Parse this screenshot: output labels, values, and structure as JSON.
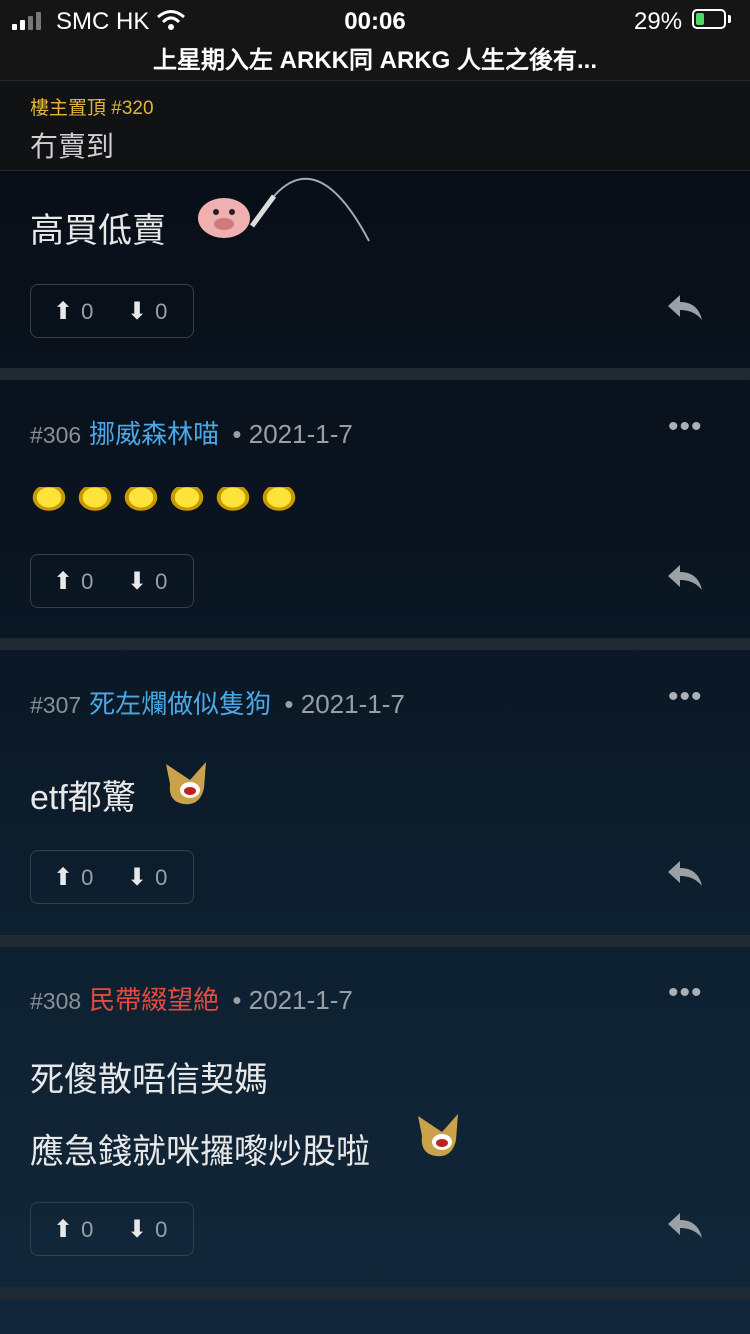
{
  "status_bar": {
    "carrier": "SMC HK",
    "time": "00:06",
    "battery": "29%",
    "battery_level": 0.29
  },
  "title": "上星期入左 ARKK同 ARKG 人生之後有...",
  "pinned": {
    "label": "樓主置頂 #320",
    "text": "冇賣到"
  },
  "first_post": {
    "body": "高買低賣",
    "up": "0",
    "down": "0"
  },
  "posts": [
    {
      "num": "#306",
      "name": "挪威森林喵",
      "date": "• 2021-1-7",
      "body": [],
      "up": "0",
      "down": "0"
    },
    {
      "num": "#307",
      "name": "死左爛做似隻狗",
      "date": "• 2021-1-7",
      "body": [
        "etf都驚"
      ],
      "up": "0",
      "down": "0"
    },
    {
      "num": "#308",
      "name": "民帶綴望絶",
      "date": "• 2021-1-7",
      "body": [
        "死傻散唔信契媽",
        "應急錢就咪攞嚟炒股啦"
      ],
      "up": "0",
      "down": "0"
    }
  ],
  "colors": {
    "name_blue": "#4aa8e8",
    "name_red": "#e24b3d",
    "pinned_label": "#e3b43c"
  }
}
